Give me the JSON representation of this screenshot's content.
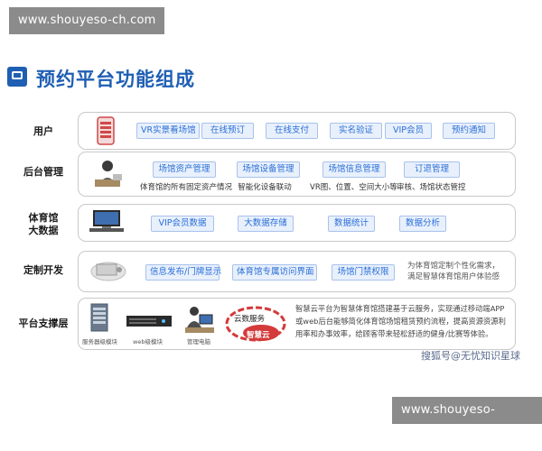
{
  "watermark_top": "www.shouyeso-ch.com",
  "watermark_bottom": "www.shouyeso-ch.com",
  "title": "预约平台功能组成",
  "rows": {
    "user": {
      "label": "用户",
      "items": [
        "VR实景看场馆",
        "在线预订",
        "在线支付",
        "实名验证",
        "VIP会员",
        "预约通知"
      ]
    },
    "backend": {
      "label": "后台管理",
      "items": [
        "场馆资产管理",
        "场馆设备管理",
        "场馆信息管理",
        "订退管理"
      ],
      "subs": [
        "体育馆的所有固定资产情况",
        "智能化设备联动",
        "VR图、位置、空间大小等",
        "审核、场馆状态管控"
      ]
    },
    "bigdata": {
      "label_line1": "体育馆",
      "label_line2": "大数据",
      "items": [
        "VIP会员数据",
        "大数据存储",
        "数据统计",
        "数据分析"
      ]
    },
    "custom": {
      "label": "定制开发",
      "items": [
        "信息发布/门牌显示",
        "体育馆专属访问界面",
        "场馆门禁权限"
      ],
      "note_line1": "为体育馆定制个性化需求，",
      "note_line2": "满足智慧体育馆用户体验感"
    },
    "support": {
      "label": "平台支撑层",
      "icon_labels": [
        "服务器级模块",
        "web级模块",
        "管理电脑"
      ],
      "cloud_text1": "云数服务",
      "cloud_text2": "智慧云",
      "note_lines": [
        "智慧云平台为智慧体育馆搭建基于云服务，实现通过移动端APP",
        "或web后台能够简化体育馆场馆租赁预约流程，提高资源资源利",
        "用率和办事效率，给顾客带来轻松舒适的健身/比赛等体验。"
      ]
    }
  },
  "footer_text": "搜狐号@无忧知识星球",
  "colors": {
    "accent": "#1f5fb3",
    "pill_text": "#2b6fd8",
    "pill_bg": "#e8f0fc",
    "cloud": "#d43a3a"
  }
}
